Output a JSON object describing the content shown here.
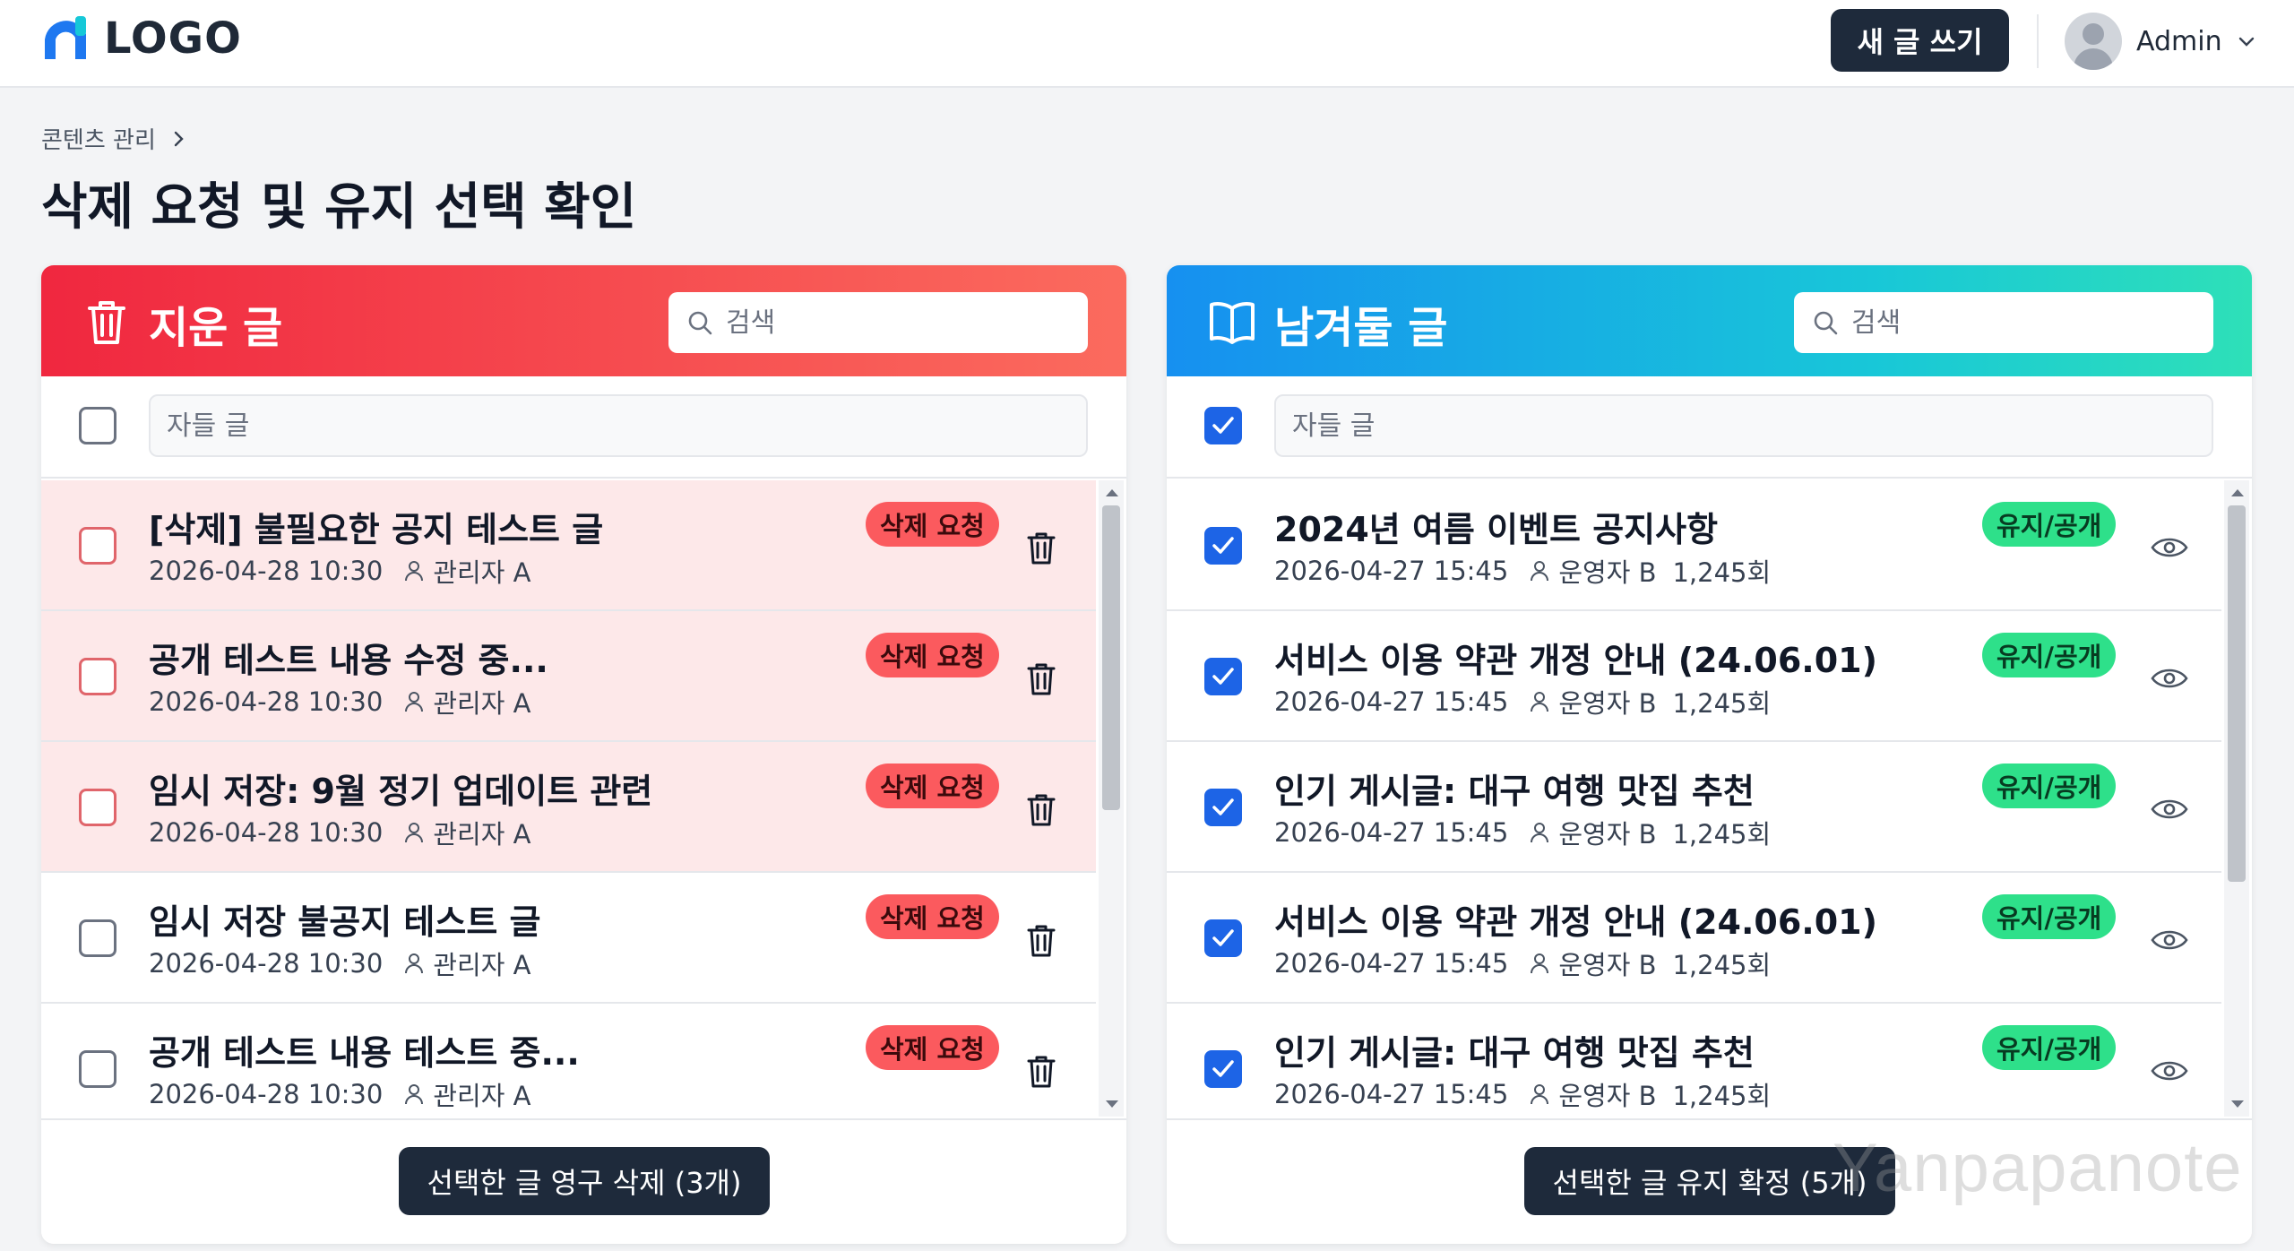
{
  "header": {
    "logo_text": "LOGO",
    "new_post_label": "새 글 쓰기",
    "user_name": "Admin"
  },
  "breadcrumb": {
    "item": "콘텐츠 관리"
  },
  "page_title": "삭제 요청 및 유지 선택 확인",
  "left_panel": {
    "title": "지운 글",
    "search_placeholder": "검색",
    "filter_placeholder": "자들 글",
    "select_all_checked": false,
    "accent_color": "#f0273f",
    "rows": [
      {
        "title": "[삭제] 불필요한 공지 테스트 글",
        "date": "2026-04-28 10:30",
        "author": "관리자 A",
        "badge": "삭제 요청",
        "highlighted": true
      },
      {
        "title": "공개 테스트 내용 수정 중...",
        "date": "2026-04-28 10:30",
        "author": "관리자 A",
        "badge": "삭제 요청",
        "highlighted": true
      },
      {
        "title": "임시 저장: 9월 정기 업데이트 관련",
        "date": "2026-04-28 10:30",
        "author": "관리자 A",
        "badge": "삭제 요청",
        "highlighted": true
      },
      {
        "title": "임시 저장 불공지 테스트 글",
        "date": "2026-04-28 10:30",
        "author": "관리자 A",
        "badge": "삭제 요청",
        "highlighted": false
      },
      {
        "title": "공개 테스트 내용 테스트 중...",
        "date": "2026-04-28 10:30",
        "author": "관리자 A",
        "badge": "삭제 요청",
        "highlighted": false
      }
    ],
    "action_label": "선택한 글 영구 삭제 (3개)"
  },
  "right_panel": {
    "title": "남겨둘 글",
    "search_placeholder": "검색",
    "filter_placeholder": "자들 글",
    "select_all_checked": true,
    "accent_color": "#1690f0",
    "rows": [
      {
        "title": "2024년 여름 이벤트 공지사항",
        "date": "2026-04-27 15:45",
        "author": "운영자 B",
        "views": "1,245회",
        "badge": "유지/공개"
      },
      {
        "title": "서비스 이용 약관 개정 안내 (24.06.01)",
        "date": "2026-04-27 15:45",
        "author": "운영자 B",
        "views": "1,245회",
        "badge": "유지/공개"
      },
      {
        "title": "인기 게시글: 대구 여행 맛집 추천",
        "date": "2026-04-27 15:45",
        "author": "운영자 B",
        "views": "1,245회",
        "badge": "유지/공개"
      },
      {
        "title": "서비스 이용 약관 개정 안내 (24.06.01)",
        "date": "2026-04-27 15:45",
        "author": "운영자 B",
        "views": "1,245회",
        "badge": "유지/공개"
      },
      {
        "title": "인기 게시글: 대구 여행 맛집 추천",
        "date": "2026-04-27 15:45",
        "author": "운영자 B",
        "views": "1,245회",
        "badge": "유지/공개"
      }
    ],
    "action_label": "선택한 글 유지 확정 (5개)"
  },
  "watermark": "Yanpapanote"
}
